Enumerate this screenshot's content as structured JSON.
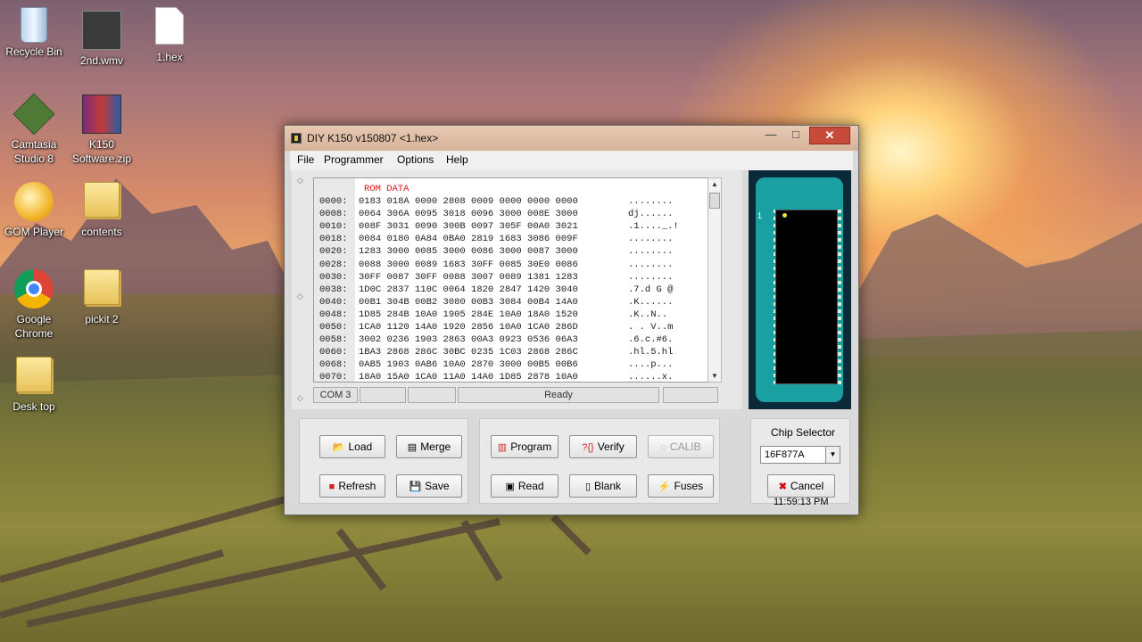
{
  "desktop": {
    "icons": [
      {
        "label": "Recycle Bin"
      },
      {
        "label": "2nd.wmv"
      },
      {
        "label": "1.hex"
      },
      {
        "label": "Camtasia Studio 8"
      },
      {
        "label": "K150 Software.zip"
      },
      {
        "label": "GOM Player"
      },
      {
        "label": "contents"
      },
      {
        "label": "Google Chrome"
      },
      {
        "label": "pickit 2"
      },
      {
        "label": "Desk top"
      }
    ]
  },
  "window": {
    "title": "DIY K150 v150807  <1.hex>",
    "controls": {
      "minimize": "—",
      "maximize": "□",
      "close": "✕"
    }
  },
  "menu": {
    "items": [
      {
        "label": "File"
      },
      {
        "label": "Programmer"
      },
      {
        "label": "Options"
      },
      {
        "label": "Help"
      }
    ]
  },
  "hex_view": {
    "title": "ROM DATA",
    "rows": [
      {
        "addr": "0000:",
        "hex": "0183 018A 0000 2808 0009 0000 0000 0000",
        "ascii": "........"
      },
      {
        "addr": "0008:",
        "hex": "0064 306A 0095 3018 0096 3000 008E 3000",
        "ascii": "dj......"
      },
      {
        "addr": "0010:",
        "hex": "008F 3031 0090 300B 0097 305F 00A0 3021",
        "ascii": ".1...._.!"
      },
      {
        "addr": "0018:",
        "hex": "0084 0180 0A84 0BA0 2819 1683 3086 009F",
        "ascii": "........"
      },
      {
        "addr": "0020:",
        "hex": "1283 3000 0085 3000 0086 3000 0087 3000",
        "ascii": "........"
      },
      {
        "addr": "0028:",
        "hex": "0088 3000 0089 1683 30FF 0085 30E0 0086",
        "ascii": "........"
      },
      {
        "addr": "0030:",
        "hex": "30FF 0087 30FF 0088 3007 0089 1381 1283",
        "ascii": "........"
      },
      {
        "addr": "0038:",
        "hex": "1D0C 2837 110C 0064 1820 2847 1420 3040",
        "ascii": ".7.d G @"
      },
      {
        "addr": "0040:",
        "hex": "00B1 304B 00B2 3080 00B3 3084 00B4 14A0",
        "ascii": ".K......"
      },
      {
        "addr": "0048:",
        "hex": "1D85 284B 10A0 1905 284E 10A0 18A0 1520",
        "ascii": ".K..N.."
      },
      {
        "addr": "0050:",
        "hex": "1CA0 1120 14A0 1920 2856 10A0 1CA0 286D",
        "ascii": ". . V..m"
      },
      {
        "addr": "0058:",
        "hex": "3002 0236 1903 2863 00A3 0923 0536 06A3",
        "ascii": ".6.c.#6."
      },
      {
        "addr": "0060:",
        "hex": "1BA3 2868 286C 30BC 0235 1C03 2868 286C",
        "ascii": ".hl.5.hl"
      },
      {
        "addr": "0068:",
        "hex": "0AB5 1903 0AB6 10A0 2870 3000 00B5 00B6",
        "ascii": "....p..."
      },
      {
        "addr": "0070:",
        "hex": "18A0 15A0 1CA0 11A0 14A0 1D85 2878 10A0",
        "ascii": "......x."
      }
    ]
  },
  "status": {
    "port": "COM 3",
    "cell2": "",
    "cell3": "",
    "message": "Ready",
    "cell5": ""
  },
  "chip": {
    "pin1_label": "1"
  },
  "buttons": {
    "load": "Load",
    "merge": "Merge",
    "refresh": "Refresh",
    "save": "Save",
    "program": "Program",
    "verify": "Verify",
    "calib": "CALIB",
    "read": "Read",
    "blank": "Blank",
    "fuses": "Fuses",
    "cancel": "Cancel"
  },
  "chip_selector": {
    "label": "Chip Selector",
    "value": "16F877A"
  },
  "clock": "11:59:13 PM"
}
